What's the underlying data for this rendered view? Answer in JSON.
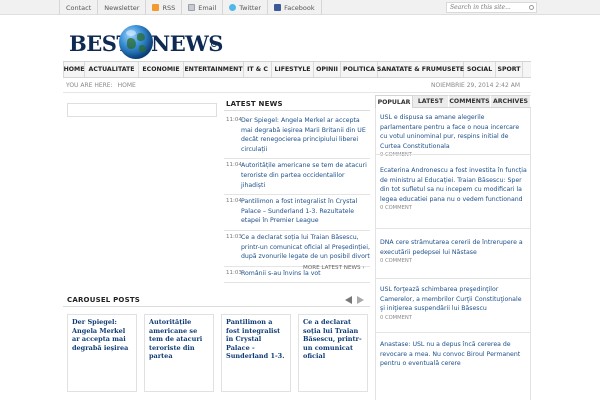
{
  "topbar": {
    "links": [
      {
        "label": "Contact",
        "icon": ""
      },
      {
        "label": "Newsletter",
        "icon": ""
      },
      {
        "label": "RSS",
        "icon": "rss-icon"
      },
      {
        "label": "Email",
        "icon": "email-icon"
      },
      {
        "label": "Twitter",
        "icon": "twitter-icon"
      },
      {
        "label": "Facebook",
        "icon": "facebook-icon"
      }
    ],
    "search_placeholder": "Search in this site..."
  },
  "logo": {
    "part1": "BEST",
    "part2": "NEWS",
    "reg": "R"
  },
  "nav": [
    "HOME",
    "ACTUALITATE",
    "ECONOMIE",
    "ENTERTAINMENT",
    "IT & C",
    "LIFESTYLE",
    "OPINII",
    "POLITICA",
    "SANATATE & FRUMUSETE",
    "SOCIAL",
    "SPORT"
  ],
  "breadcrumb": {
    "prefix": "YOU ARE HERE:",
    "current": "HOME"
  },
  "datetime": "NOIEMBRIE 29, 2014 2:42 AM",
  "latest": {
    "title": "LATEST NEWS",
    "items": [
      {
        "time": "11:04",
        "text": "Der Spiegel: Angela Merkel ar accepta mai degrabă ieșirea Marii Britanii din UE decât renegocierea principiului liberei circulații"
      },
      {
        "time": "11:04",
        "text": "Autoritățile americane se tem de atacuri teroriste din partea occidentalilor jihadiști"
      },
      {
        "time": "11:04",
        "text": "Pantilimon a fost integralist în Crystal Palace – Sunderland 1-3. Rezultatele etapei în Premier League"
      },
      {
        "time": "11:03",
        "text": "Ce a declarat soția lui Traian Băsescu, printr-un comunicat oficial al Președinției, după zvonurile legate de un posibil divort"
      },
      {
        "time": "11:03",
        "text": "Românii s-au învins la vot"
      }
    ],
    "more": "MORE LATEST NEWS ›"
  },
  "carousel": {
    "title": "CAROUSEL POSTS",
    "cards": [
      "Der Spiegel: Angela Merkel ar accepta mai degrabă ieșirea",
      "Autoritățile americane se tem de atacuri teroriste din partea",
      "Pantilimon a fost integralist în Crystal Palace - Sunderland 1-3.",
      "Ce a declarat soția lui Traian Băsescu, printr-un comunicat oficial"
    ]
  },
  "tabs": [
    "POPULAR",
    "LATEST",
    "COMMENTS",
    "ARCHIVES"
  ],
  "popular": [
    {
      "text": "USL e dispusa sa amane alegerile parlamentare pentru a face o noua incercare cu votul uninominal pur, respins initial de Curtea Constitutionala",
      "comment": "0 COMMENT"
    },
    {
      "text": "Ecaterina Andronescu a fost investita în funcția de ministru al Educației. Traian Băsescu: Sper din tot sufletul sa nu incepem cu modificari la legea educatiei pana nu o vedem functionand",
      "comment": "0 COMMENT"
    },
    {
      "text": "DNA cere strămutarea cererii de întrerupere a executării pedepsei lui Năstase",
      "comment": "0 COMMENT"
    },
    {
      "text": "USL forţează schimbarea preşedinţilor Camerelor, a membrilor Curţii Constituţionale şi iniţierea suspendării lui Băsescu",
      "comment": "0 COMMENT"
    },
    {
      "text": "Anastase: USL nu a depus încă cererea de revocare a mea. Nu convoc Biroul Permanent pentru o eventuală cerere",
      "comment": ""
    }
  ],
  "colors": {
    "link": "#1d4f8a",
    "logo": "#0f2a52",
    "card_title": "#0f3b75"
  }
}
